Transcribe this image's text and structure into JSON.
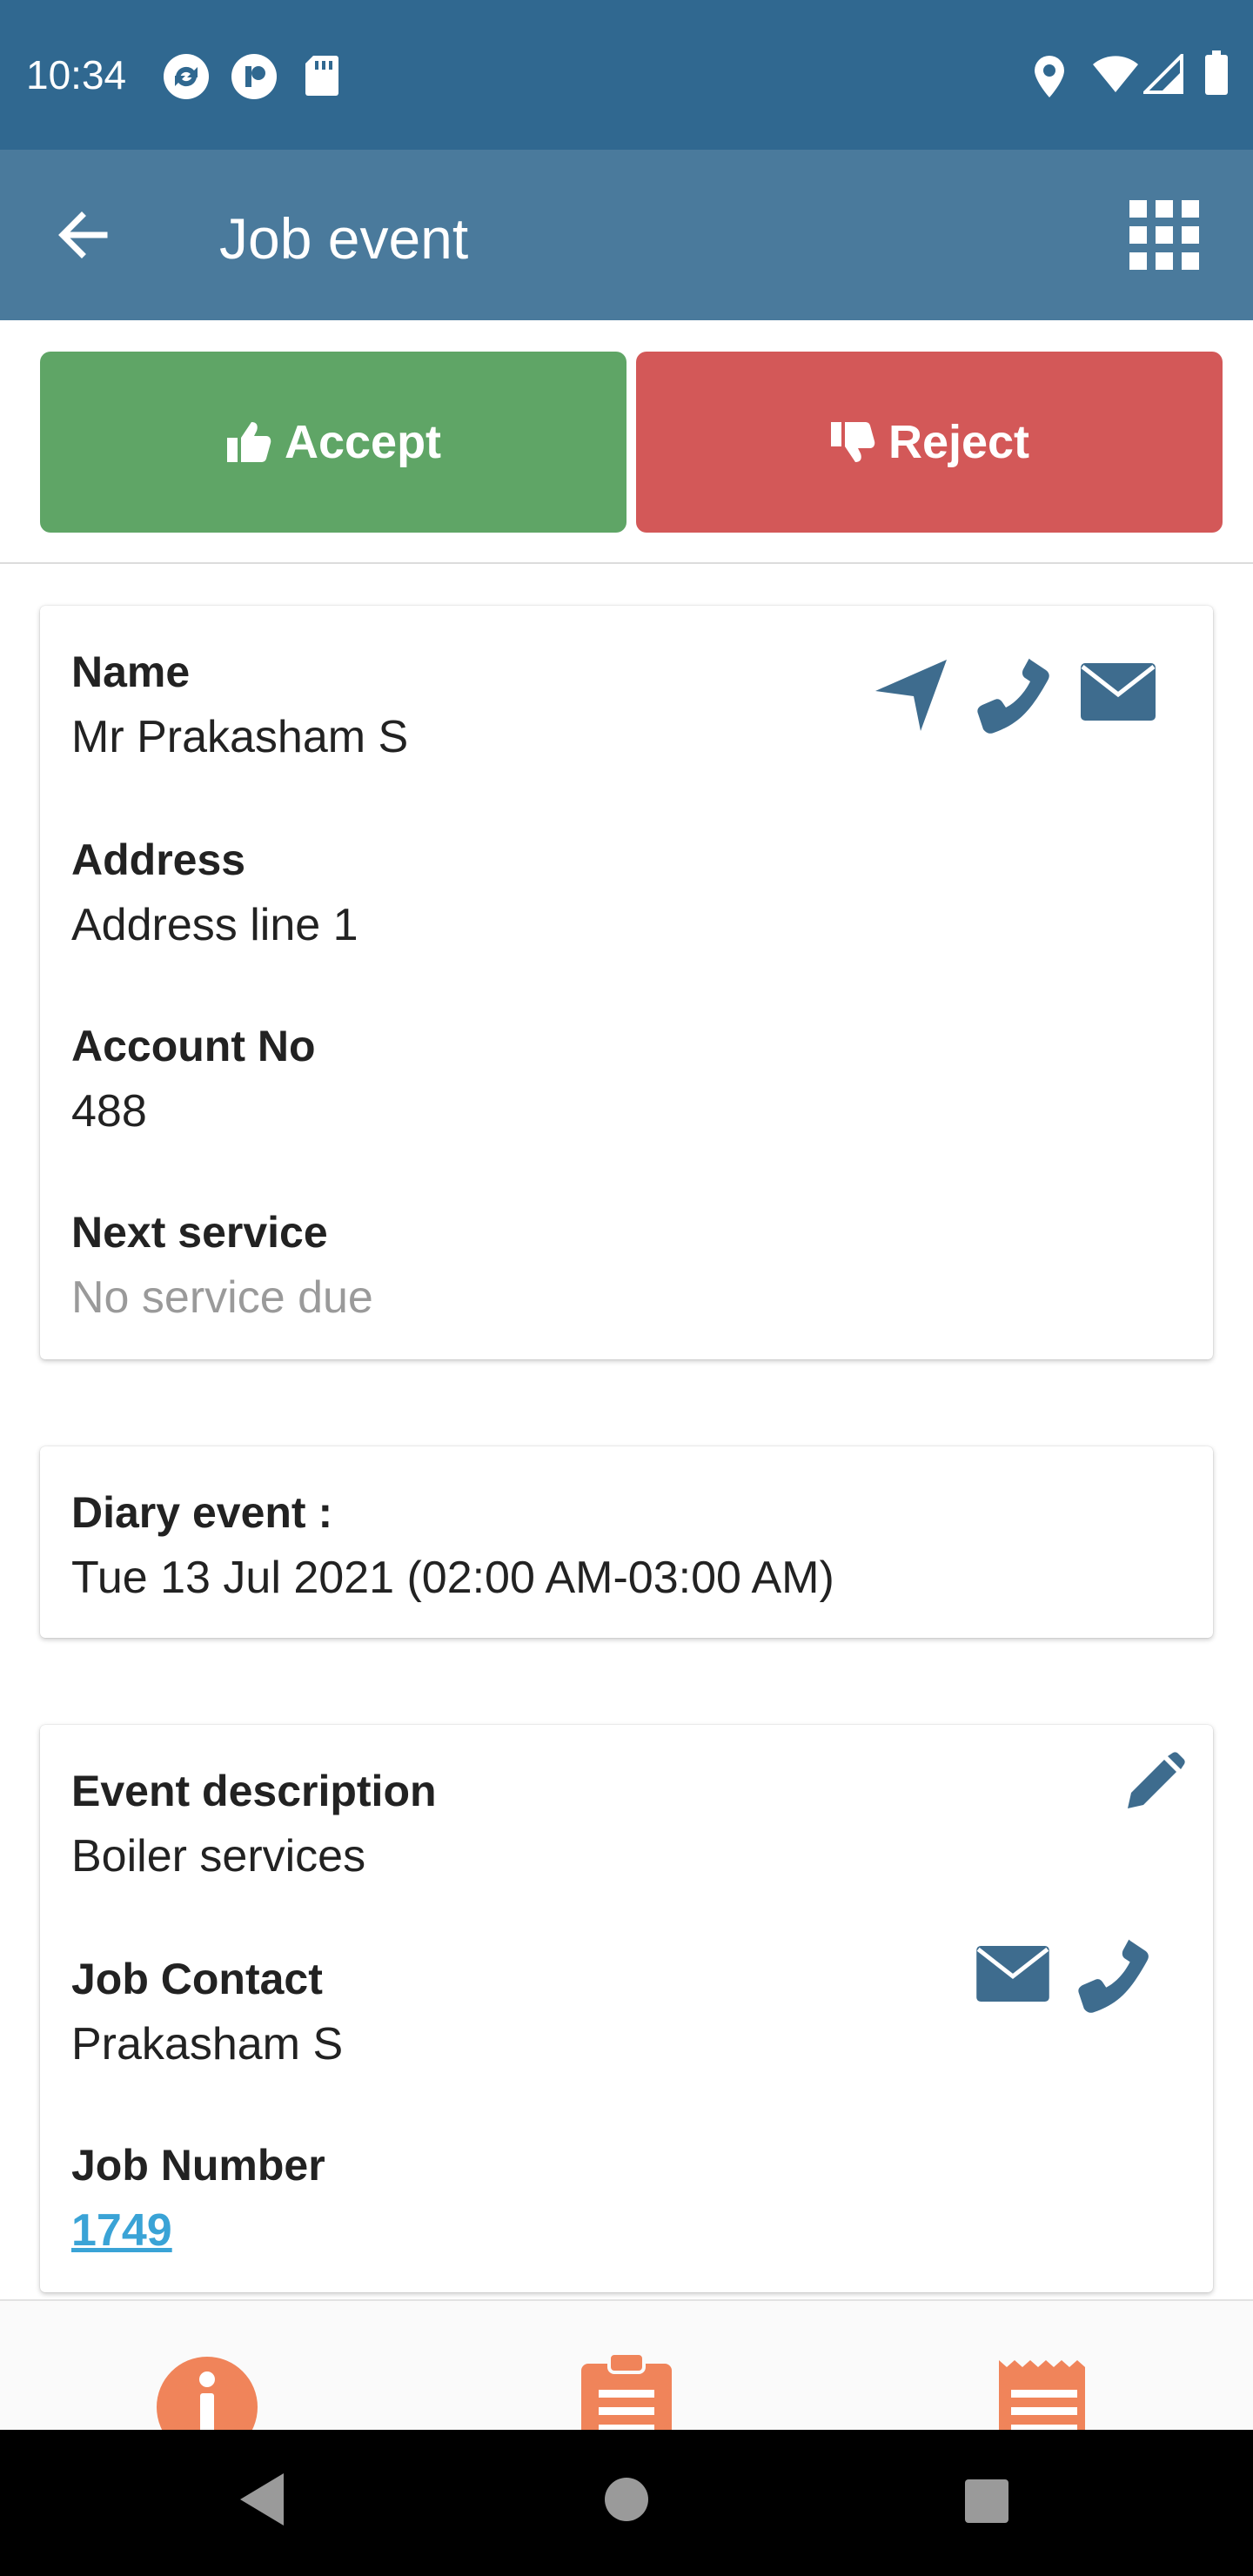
{
  "status_bar": {
    "time": "10:34",
    "icons": [
      "sync-icon",
      "app-icon",
      "sd-card-icon",
      "location-icon",
      "wifi-icon",
      "signal-icon",
      "battery-icon"
    ]
  },
  "app_bar": {
    "title": "Job event",
    "icons": [
      "back-arrow-icon",
      "grid-menu-icon"
    ]
  },
  "actions": {
    "accept_label": "Accept",
    "reject_label": "Reject",
    "accept_color": "#5fa566",
    "reject_color": "#d35858"
  },
  "customer_card": {
    "name_label": "Name",
    "name_value": "Mr Prakasham S",
    "address_label": "Address",
    "address_value": "Address line 1",
    "account_label": "Account No",
    "account_value": "488",
    "next_service_label": "Next service",
    "next_service_value": "No service due",
    "icons": [
      "navigate-icon",
      "phone-icon",
      "email-icon"
    ]
  },
  "diary_card": {
    "label": "Diary event :",
    "value": "Tue 13 Jul 2021 (02:00 AM-03:00 AM)"
  },
  "event_card": {
    "description_label": "Event description",
    "description_value": "Boiler services",
    "contact_label": "Job Contact",
    "contact_value": "Prakasham S",
    "job_number_label": "Job Number",
    "job_number_value": "1749",
    "icons": [
      "edit-icon",
      "email-icon",
      "phone-icon"
    ]
  },
  "bottom_nav": {
    "items": [
      "info-icon",
      "clipboard-icon",
      "receipt-icon"
    ],
    "accent": "#f0845a"
  },
  "colors": {
    "status_bar": "#306890",
    "app_bar": "#4a7a9c",
    "icon_blue": "#3e6c8e",
    "link": "#3aa3d6"
  }
}
